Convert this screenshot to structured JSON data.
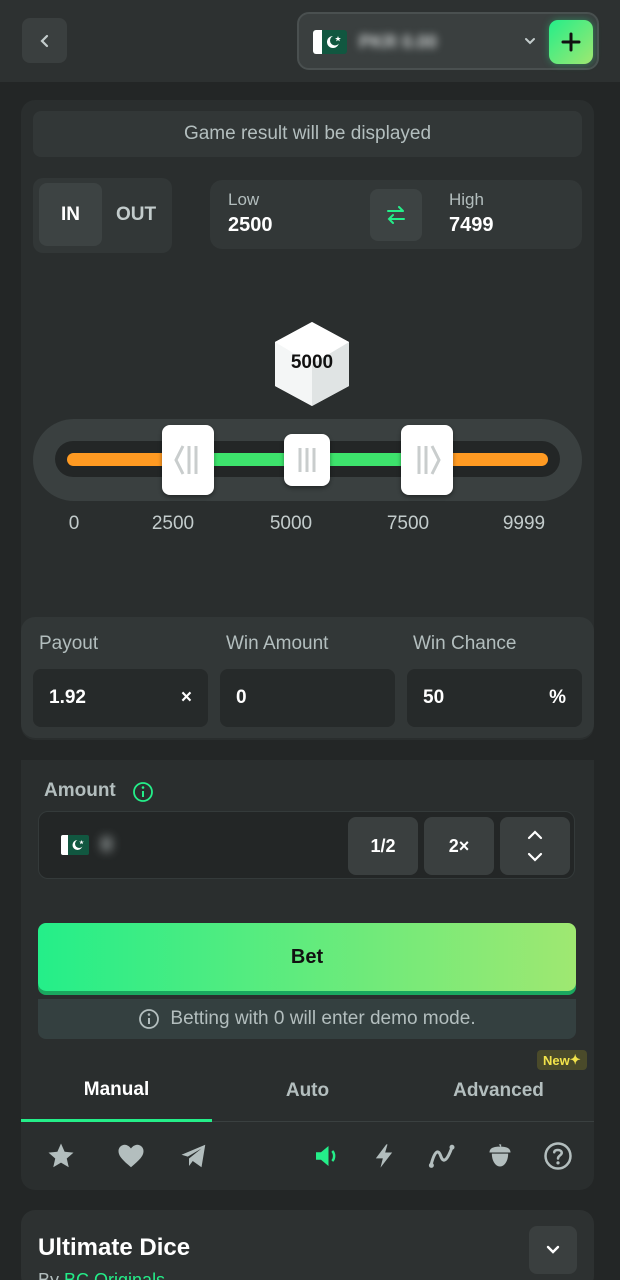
{
  "header": {
    "back_icon": "chevron-left-icon",
    "wallet": {
      "flag": "pakistan-flag",
      "balance": "PKR 0.00",
      "dropdown_icon": "chevron-down-icon"
    },
    "deposit_icon": "plus-icon",
    "accent_color": "#24ee89"
  },
  "game": {
    "result_banner": "Game result will be displayed",
    "mode_in_label": "IN",
    "mode_out_label": "OUT",
    "selected_mode": "IN",
    "range": {
      "low_label": "Low",
      "low_value": "2500",
      "high_label": "High",
      "high_value": "7499",
      "swap_icon": "swap-arrows-icon"
    },
    "dice_value": "5000",
    "slider": {
      "min": 0,
      "max": 9999,
      "low": 2500,
      "mid": 5000,
      "high": 7499,
      "in_color": "#3de36c",
      "out_color": "#ff9a22"
    },
    "ticks": [
      "0",
      "2500",
      "5000",
      "7500",
      "9999"
    ]
  },
  "stats": {
    "payout_label": "Payout",
    "payout_value": "1.92",
    "payout_unit": "×",
    "win_amount_label": "Win Amount",
    "win_amount_value": "0",
    "win_chance_label": "Win Chance",
    "win_chance_value": "50",
    "win_chance_unit": "%"
  },
  "bet": {
    "amount_label": "Amount",
    "amount_value": "0",
    "half_label": "1/2",
    "double_label": "2×",
    "bet_label": "Bet",
    "demo_note": "Betting with 0 will enter demo mode."
  },
  "tabs": [
    {
      "label": "Manual",
      "active": true
    },
    {
      "label": "Auto",
      "active": false
    },
    {
      "label": "Advanced",
      "active": false
    }
  ],
  "new_badge": "New",
  "toolbar_icons": [
    "star-icon",
    "heart-icon",
    "telegram-icon",
    "sound-icon",
    "lightning-icon",
    "graph-icon",
    "acorn-icon",
    "help-icon"
  ],
  "info": {
    "title": "Ultimate Dice",
    "by_prefix": "By",
    "provider": "BC Originals"
  }
}
